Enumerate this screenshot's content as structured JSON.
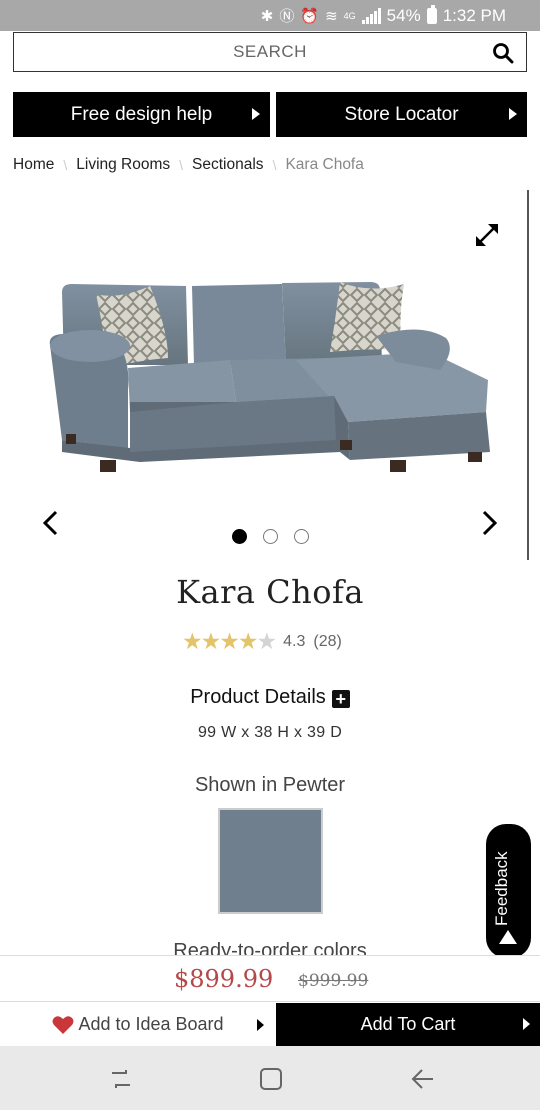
{
  "status_bar": {
    "battery": "54%",
    "time": "1:32 PM",
    "network": "4G"
  },
  "search": {
    "placeholder": "SEARCH"
  },
  "nav_buttons": {
    "design_help": "Free design help",
    "store_locator": "Store Locator"
  },
  "breadcrumb": [
    "Home",
    "Living Rooms",
    "Sectionals",
    "Kara Chofa"
  ],
  "gallery": {
    "slide_count": 3,
    "active_slide": 1
  },
  "product": {
    "name": "Kara Chofa",
    "rating": "4.3",
    "rating_value": 4.3,
    "review_count": "(28)",
    "details_label": "Product Details",
    "dimensions": "99 W x 38 H x 39 D",
    "shown_in": "Shown in Pewter",
    "swatch_color": "#6f7f8d",
    "ready_to_order": "Ready-to-order colors"
  },
  "pricing": {
    "price": "$899.99",
    "old_price": "$999.99",
    "price_color": "#b5484a"
  },
  "feedback": {
    "label": "Feedback"
  },
  "actions": {
    "idea_board": "Add to Idea Board",
    "add_to_cart": "Add To Cart"
  },
  "colors": {
    "star": "#e3c46a",
    "heart": "#c9373a"
  }
}
